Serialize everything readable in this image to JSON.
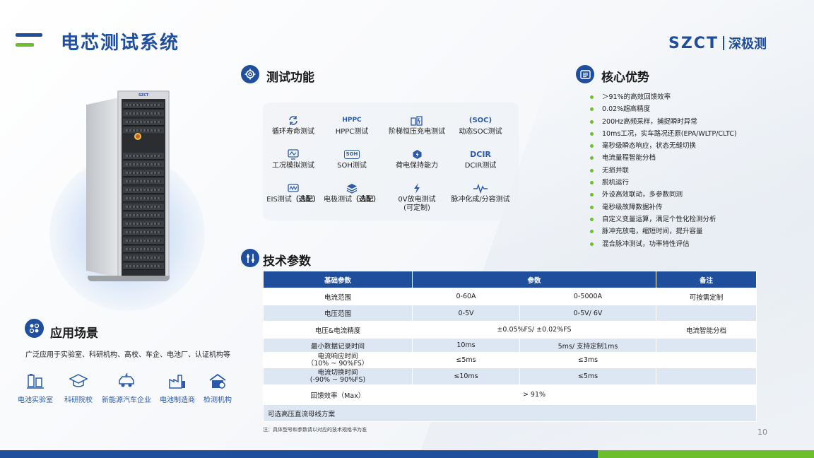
{
  "header": {
    "title": "电芯测试系统",
    "logo_mark": "SZCT",
    "logo_cn": "深极测"
  },
  "cabinet": {
    "brand": "SZCT"
  },
  "test_functions": {
    "title": "测试功能",
    "items": [
      {
        "label": "循环寿命测试",
        "icon": "cycle-icon"
      },
      {
        "label": "HPPC测试",
        "icon_text": "HPPC"
      },
      {
        "label": "阶梯恒压充电测试",
        "icon": "battery-charge-icon"
      },
      {
        "label": "动态SOC测试",
        "icon_text": "(SOC)"
      },
      {
        "label": "工况模拟测试",
        "icon": "waveform-monitor-icon"
      },
      {
        "label": "SOH测试",
        "icon_text": "SOH"
      },
      {
        "label": "荷电保持能力",
        "icon": "power-hold-icon"
      },
      {
        "label": "DCIR测试",
        "icon_text": "DCIR"
      },
      {
        "label": "EIS测试",
        "extra": "（选配）",
        "icon": "eis-monitor-icon"
      },
      {
        "label": "电极测试",
        "extra": "（选配）",
        "icon": "layers-icon"
      },
      {
        "label": "0V放电测试",
        "extra": "(可定制)",
        "icon": "lightning-icon"
      },
      {
        "label": "脉冲化成/分容测试",
        "icon": "pulse-icon"
      }
    ]
  },
  "advantages": {
    "title": "核心优势",
    "items": [
      "＞91%的高效回馈效率",
      "0.02%超高精度",
      "200Hz高频采样，捕捉瞬时异常",
      "10ms工况，实车路况还原(EPA/WLTP/CLTC)",
      "毫秒级瞬态响应，状态无缝切换",
      "电流量程智能分档",
      "无损并联",
      "脱机运行",
      "外设高效联动，多参数同测",
      "毫秒级故障数据补传",
      "自定义变量运算，满足个性化检测分析",
      "脉冲充放电，缩短时间，提升容量",
      "混合脉冲测试，功率特性评估"
    ]
  },
  "specs": {
    "title": "技术参数",
    "headers": {
      "basic": "基础参数",
      "param": "参数",
      "note": "备注"
    },
    "rows": {
      "current_range": {
        "name": "电流范围",
        "a": "0-60A",
        "b": "0-5000A",
        "note": "可按需定制"
      },
      "voltage_range": {
        "name": "电压范围",
        "a": "0-5V",
        "b": "0-5V/ 6V",
        "note": ""
      },
      "accuracy": {
        "name": "电压&电流精度",
        "value": "±0.05%FS/ ±0.02%FS",
        "note": "电流智能分档"
      },
      "min_record": {
        "name": "最小数据记录时间",
        "a": "10ms",
        "b": "5ms/ 支持定制1ms",
        "note": ""
      },
      "response": {
        "name": "电流响应时间",
        "sub": "（10% ~ 90%FS）",
        "a": "≤5ms",
        "b": "≤3ms",
        "note": ""
      },
      "switch": {
        "name": "电流切换时间",
        "sub": "(-90% ~ 90%FS)",
        "a": "≤10ms",
        "b": "≤5ms",
        "note": ""
      },
      "feedback": {
        "name": "回馈效率（Max）",
        "value": "> 91%",
        "note": ""
      }
    },
    "option_row": "可选高压直流母线方案",
    "footnote": "注：具体型号和参数请以对应的技术规格书为准"
  },
  "applications": {
    "title": "应用场景",
    "description": "广泛应用于实验室、科研机构、高校、车企、电池厂、认证机构等",
    "items": [
      {
        "label": "电池实验室",
        "icon": "battery-lab-icon"
      },
      {
        "label": "科研院校",
        "icon": "graduation-cap-icon"
      },
      {
        "label": "新能源汽车企业",
        "icon": "ev-car-icon"
      },
      {
        "label": "电池制造商",
        "icon": "factory-icon"
      },
      {
        "label": "检测机构",
        "icon": "inspection-house-icon"
      }
    ]
  },
  "page_number": "10",
  "colors": {
    "primary": "#1f4e9c",
    "accent_green": "#6cbf2a",
    "row_alt": "#dde6f3"
  }
}
